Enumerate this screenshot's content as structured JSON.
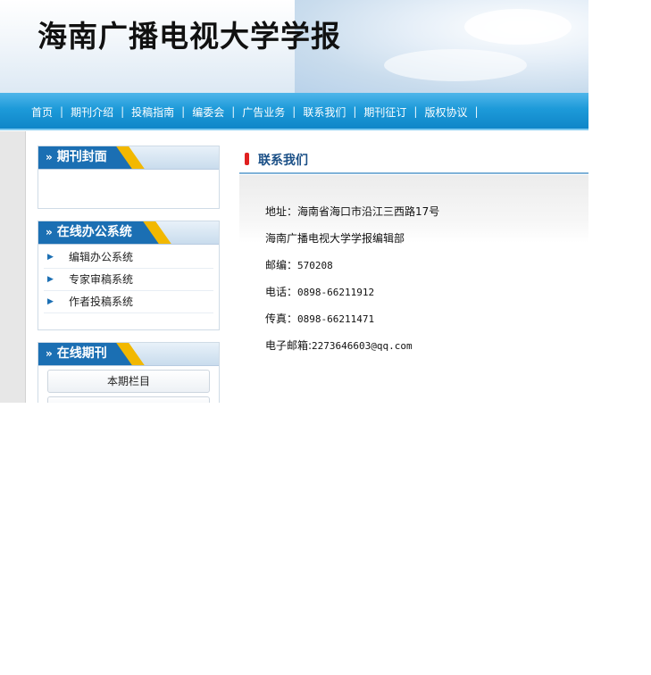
{
  "header": {
    "title": "海南广播电视大学学报"
  },
  "nav": {
    "items": [
      "首页",
      "期刊介绍",
      "投稿指南",
      "编委会",
      "广告业务",
      "联系我们",
      "期刊征订",
      "版权协议"
    ],
    "separator": "|"
  },
  "sidebar": {
    "cover": {
      "title": "期刊封面"
    },
    "office": {
      "title": "在线办公系统",
      "items": [
        "编辑办公系统",
        "专家审稿系统",
        "作者投稿系统"
      ]
    },
    "online": {
      "title": "在线期刊",
      "button": "本期栏目"
    }
  },
  "content": {
    "title": "联系我们",
    "address_label": "地址：",
    "address_value": "海南省海口市沿江三西路17号",
    "org": "海南广播电视大学学报编辑部",
    "postcode_label": "邮编：",
    "postcode_value": "570208",
    "phone_label": "电话：",
    "phone_value": "0898-66211912",
    "fax_label": "传真：",
    "fax_value": "0898-66211471",
    "email_label": "电子邮箱:",
    "email_value": "2273646603@qq.com"
  },
  "colors": {
    "nav": "#1d9ad9",
    "tab": "#1b6fb3",
    "tab_stripe": "#f2b800",
    "content_title": "#1a4f86",
    "marker": "#e02020"
  }
}
